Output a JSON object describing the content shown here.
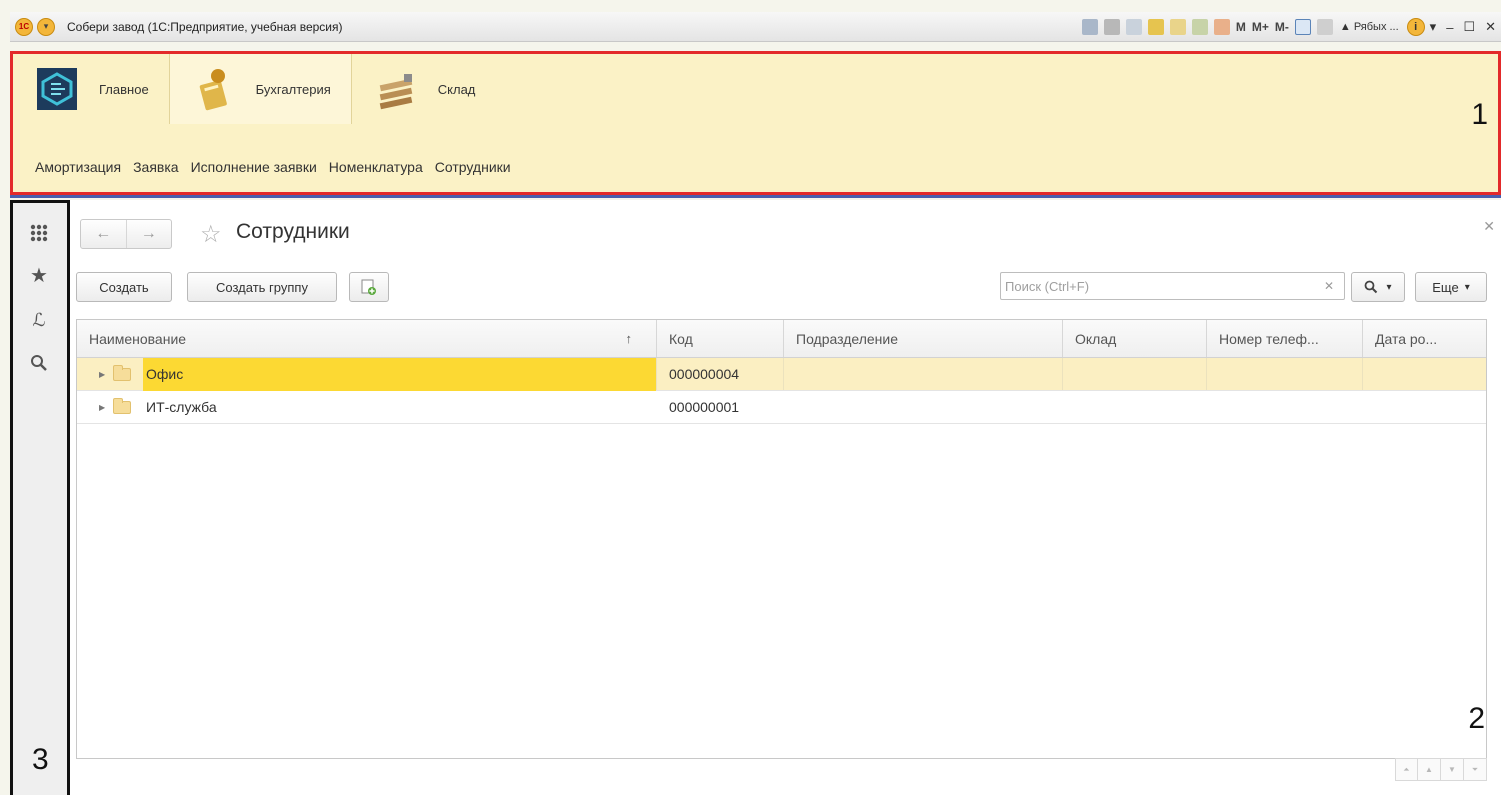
{
  "window": {
    "title": "Собери завод (1С:Предприятие, учебная версия)",
    "logo_text": "1С",
    "toolbar_m": [
      "M",
      "M+",
      "M-"
    ],
    "user": "Рябых ..."
  },
  "sections": {
    "items": [
      {
        "label": "Главное",
        "icon": "main-section-icon"
      },
      {
        "label": "Бухгалтерия",
        "icon": "accounting-section-icon"
      },
      {
        "label": "Склад",
        "icon": "warehouse-section-icon"
      }
    ],
    "sub_items": [
      "Амортизация",
      "Заявка",
      "Исполнение заявки",
      "Номенклатура",
      "Сотрудники"
    ]
  },
  "annotations": {
    "one": "1",
    "two": "2",
    "three": "3"
  },
  "form": {
    "title": "Сотрудники",
    "create_label": "Создать",
    "create_group_label": "Создать группу",
    "search_placeholder": "Поиск (Ctrl+F)",
    "more_label": "Еще"
  },
  "table": {
    "columns": [
      "Наименование",
      "Код",
      "Подразделение",
      "Оклад",
      "Номер телеф...",
      "Дата ро..."
    ],
    "sort_indicator": "↑",
    "rows": [
      {
        "name": "Офис",
        "code": "000000004",
        "selected": true
      },
      {
        "name": "ИТ-служба",
        "code": "000000001",
        "selected": false
      }
    ]
  },
  "colors": {
    "section_bg": "#fbf2c6",
    "highlight_frame_red": "#e32a2a",
    "highlight_frame_black": "#111111",
    "selected_row": "#fbefc2",
    "selected_cell": "#fcd933"
  }
}
